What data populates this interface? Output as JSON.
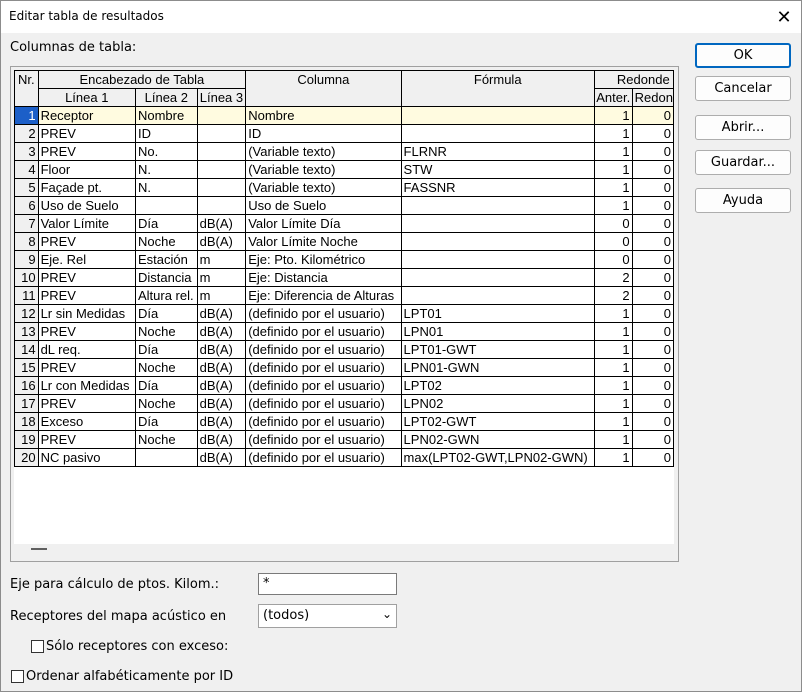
{
  "dialog": {
    "title": "Editar tabla de resultados",
    "section_label": "Columnas de tabla:"
  },
  "grid": {
    "header_top": [
      "Nr.",
      "Encabezado de Tabla",
      "Columna",
      "Fórmula",
      "Redonde"
    ],
    "header_sub": [
      "Línea 1",
      "Línea 2",
      "Línea 3",
      "Anter.",
      "Redon"
    ],
    "rows": [
      [
        "1",
        "Receptor",
        "Nombre",
        "",
        "Nombre",
        "",
        "1",
        "0"
      ],
      [
        "2",
        "PREV",
        "ID",
        "",
        "ID",
        "",
        "1",
        "0"
      ],
      [
        "3",
        "PREV",
        "No.",
        "",
        "(Variable texto)",
        "FLRNR",
        "1",
        "0"
      ],
      [
        "4",
        "Floor",
        "N.",
        "",
        "(Variable texto)",
        "STW",
        "1",
        "0"
      ],
      [
        "5",
        "Façade pt.",
        "N.",
        "",
        "(Variable texto)",
        "FASSNR",
        "1",
        "0"
      ],
      [
        "6",
        "Uso de Suelo",
        "",
        "",
        "Uso de Suelo",
        "",
        "1",
        "0"
      ],
      [
        "7",
        "Valor Límite",
        "Día",
        "dB(A)",
        "Valor Límite Día",
        "",
        "0",
        "0"
      ],
      [
        "8",
        "PREV",
        "Noche",
        "dB(A)",
        "Valor Límite Noche",
        "",
        "0",
        "0"
      ],
      [
        "9",
        "Eje. Rel",
        "Estación",
        "m",
        "Eje: Pto. Kilométrico",
        "",
        "0",
        "0"
      ],
      [
        "10",
        "PREV",
        "Distancia",
        "m",
        "Eje: Distancia",
        "",
        "2",
        "0"
      ],
      [
        "11",
        "PREV",
        "Altura rel.",
        "m",
        "Eje: Diferencia de Alturas",
        "",
        "2",
        "0"
      ],
      [
        "12",
        "Lr sin Medidas",
        "Día",
        "dB(A)",
        "(definido por el usuario)",
        "LPT01",
        "1",
        "0"
      ],
      [
        "13",
        "PREV",
        "Noche",
        "dB(A)",
        "(definido por el usuario)",
        "LPN01",
        "1",
        "0"
      ],
      [
        "14",
        "dL req.",
        "Día",
        "dB(A)",
        "(definido por el usuario)",
        "LPT01-GWT",
        "1",
        "0"
      ],
      [
        "15",
        "PREV",
        "Noche",
        "dB(A)",
        "(definido por el usuario)",
        "LPN01-GWN",
        "1",
        "0"
      ],
      [
        "16",
        "Lr con Medidas",
        "Día",
        "dB(A)",
        "(definido por el usuario)",
        "LPT02",
        "1",
        "0"
      ],
      [
        "17",
        "PREV",
        "Noche",
        "dB(A)",
        "(definido por el usuario)",
        "LPN02",
        "1",
        "0"
      ],
      [
        "18",
        "Exceso",
        "Día",
        "dB(A)",
        "(definido por el usuario)",
        "LPT02-GWT",
        "1",
        "0"
      ],
      [
        "19",
        "PREV",
        "Noche",
        "dB(A)",
        "(definido por el usuario)",
        "LPN02-GWN",
        "1",
        "0"
      ],
      [
        "20",
        "NC pasivo",
        "",
        "dB(A)",
        "(definido por el usuario)",
        "max(LPT02-GWT,LPN02-GWN)",
        "1",
        "0"
      ]
    ]
  },
  "buttons": {
    "ok": "OK",
    "cancel": "Cancelar",
    "open": "Abrir...",
    "save": "Guardar...",
    "help": "Ayuda"
  },
  "form": {
    "axis_label": "Eje para cálculo de ptos. Kilom.:",
    "axis_value": "*",
    "receivers_label": "Receptores del mapa acústico en",
    "receivers_value": "(todos)",
    "only_exceed_label": "Sólo receptores con exceso:",
    "sort_label": "Ordenar alfabéticamente por ID"
  },
  "icons": {
    "close": "close-icon",
    "dropdown": "chevron-down-icon"
  }
}
